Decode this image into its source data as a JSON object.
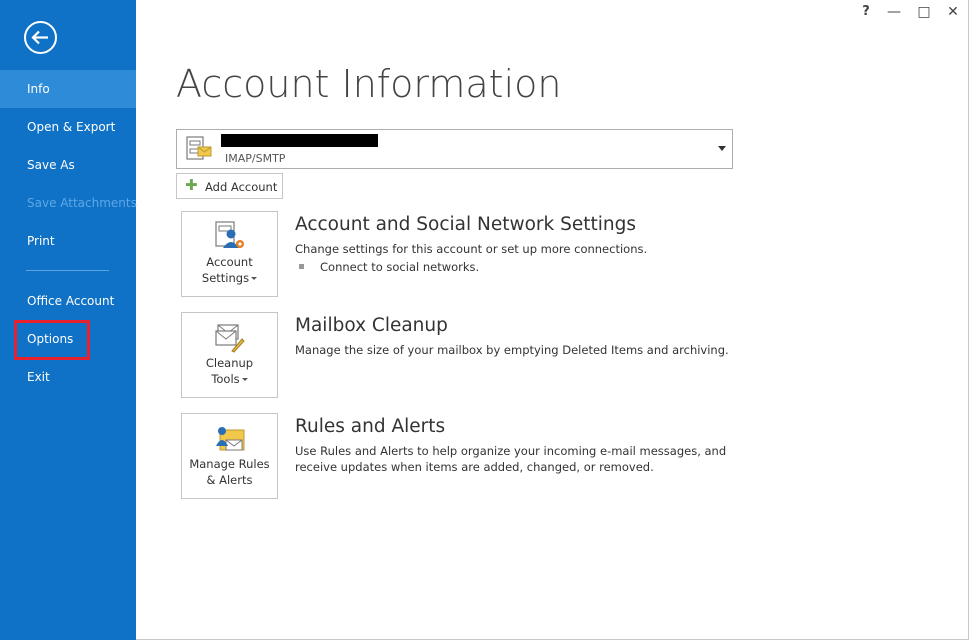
{
  "sidebar": {
    "items": [
      {
        "label": "Info"
      },
      {
        "label": "Open & Export"
      },
      {
        "label": "Save As"
      },
      {
        "label": "Save Attachments"
      },
      {
        "label": "Print"
      },
      {
        "label": "Office Account"
      },
      {
        "label": "Options"
      },
      {
        "label": "Exit"
      }
    ],
    "active": "Info",
    "highlighted": "Options"
  },
  "window_controls": {
    "help": "?",
    "minimize": "—",
    "maximize": "□",
    "close": "✕"
  },
  "main": {
    "title": "Account Information",
    "account": {
      "type": "IMAP/SMTP"
    },
    "add_account_label": "Add Account",
    "sections": [
      {
        "tile_label_1": "Account",
        "tile_label_2": "Settings",
        "icon": "account-settings-icon",
        "title": "Account and Social Network Settings",
        "description": "Change settings for this account or set up more connections.",
        "bullet": "Connect to social networks."
      },
      {
        "tile_label_1": "Cleanup",
        "tile_label_2": "Tools",
        "icon": "cleanup-tools-icon",
        "title": "Mailbox Cleanup",
        "description": "Manage the size of your mailbox by emptying Deleted Items and archiving."
      },
      {
        "tile_label_1": "Manage Rules",
        "tile_label_2": "& Alerts",
        "icon": "rules-alerts-icon",
        "title": "Rules and Alerts",
        "description": "Use Rules and Alerts to help organize your incoming e-mail messages, and receive updates when items are added, changed, or removed."
      }
    ]
  },
  "colors": {
    "sidebar": "#0f72c6",
    "sidebar_active": "#2e8bd8",
    "highlight_box": "#e8212f"
  }
}
